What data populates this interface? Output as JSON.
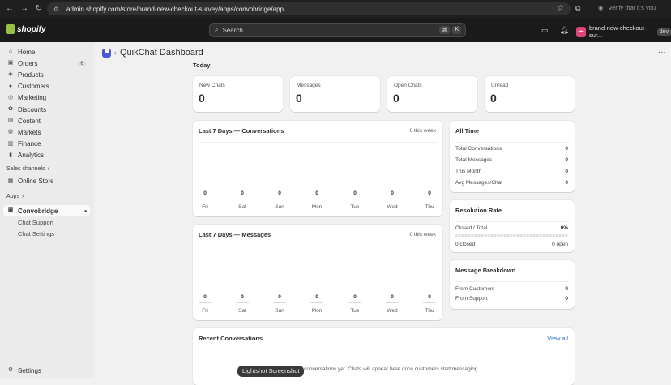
{
  "browser": {
    "url": "admin.shopify.com/store/brand-new-checkout-survey/apps/convobridge/app",
    "verify_text": "Verify that it's you"
  },
  "topbar": {
    "logo_text": "shopify",
    "search_placeholder": "Search",
    "shortcut": [
      "⌘",
      "K"
    ],
    "store_initials": "•••",
    "store_name": "brand-new-checkout-sur...",
    "store_badge": "dev"
  },
  "sidebar": {
    "items": [
      {
        "label": "Home",
        "icon": "home-icon",
        "glyph": "⌂"
      },
      {
        "label": "Orders",
        "icon": "orders-icon",
        "glyph": "▣",
        "badge": "6"
      },
      {
        "label": "Products",
        "icon": "products-icon",
        "glyph": "◈"
      },
      {
        "label": "Customers",
        "icon": "customers-icon",
        "glyph": "●"
      },
      {
        "label": "Marketing",
        "icon": "marketing-icon",
        "glyph": "◎"
      },
      {
        "label": "Discounts",
        "icon": "discounts-icon",
        "glyph": "✿"
      },
      {
        "label": "Content",
        "icon": "content-icon",
        "glyph": "▤"
      },
      {
        "label": "Markets",
        "icon": "markets-icon",
        "glyph": "◍"
      },
      {
        "label": "Finance",
        "icon": "finance-icon",
        "glyph": "▥"
      },
      {
        "label": "Analytics",
        "icon": "analytics-icon",
        "glyph": "▮"
      }
    ],
    "sales_channels_label": "Sales channels",
    "online_store_label": "Online Store",
    "apps_label": "Apps",
    "app_label": "Convobridge",
    "app_subitems": [
      "Chat Support",
      "Chat Settings"
    ],
    "settings_label": "Settings"
  },
  "page": {
    "title": "QuikChat Dashboard",
    "today_label": "Today"
  },
  "stats": [
    {
      "label": "New Chats",
      "value": "0"
    },
    {
      "label": "Messages",
      "value": "0"
    },
    {
      "label": "Open Chats",
      "value": "0"
    },
    {
      "label": "Unread",
      "value": "0"
    }
  ],
  "conversations_chart": {
    "title": "Last 7 Days — Conversations",
    "summary": "0 this week",
    "days": [
      "Fri",
      "Sat",
      "Sun",
      "Mon",
      "Tue",
      "Wed",
      "Thu"
    ],
    "values": [
      "0",
      "0",
      "0",
      "0",
      "0",
      "0",
      "0"
    ]
  },
  "messages_chart": {
    "title": "Last 7 Days — Messages",
    "summary": "0 this week",
    "days": [
      "Fri",
      "Sat",
      "Sun",
      "Mon",
      "Tue",
      "Wed",
      "Thu"
    ],
    "values": [
      "0",
      "0",
      "0",
      "0",
      "0",
      "0",
      "0"
    ]
  },
  "all_time": {
    "title": "All Time",
    "rows": [
      {
        "label": "Total Conversations",
        "value": "0"
      },
      {
        "label": "Total Messages",
        "value": "0"
      },
      {
        "label": "This Month",
        "value": "0"
      },
      {
        "label": "Avg Messages/Chat",
        "value": "0"
      }
    ]
  },
  "resolution": {
    "title": "Resolution Rate",
    "label": "Closed / Total",
    "percent": "0%",
    "closed": "0 closed",
    "open": "0 open"
  },
  "breakdown": {
    "title": "Message Breakdown",
    "rows": [
      {
        "label": "From Customers",
        "value": "0"
      },
      {
        "label": "From Support",
        "value": "0"
      }
    ]
  },
  "recent": {
    "title": "Recent Conversations",
    "view_all": "View all",
    "empty_text": "No conversations yet. Chats will appear here once customers start messaging."
  },
  "overlay": {
    "tooltip": "Lightshot Screenshot"
  }
}
